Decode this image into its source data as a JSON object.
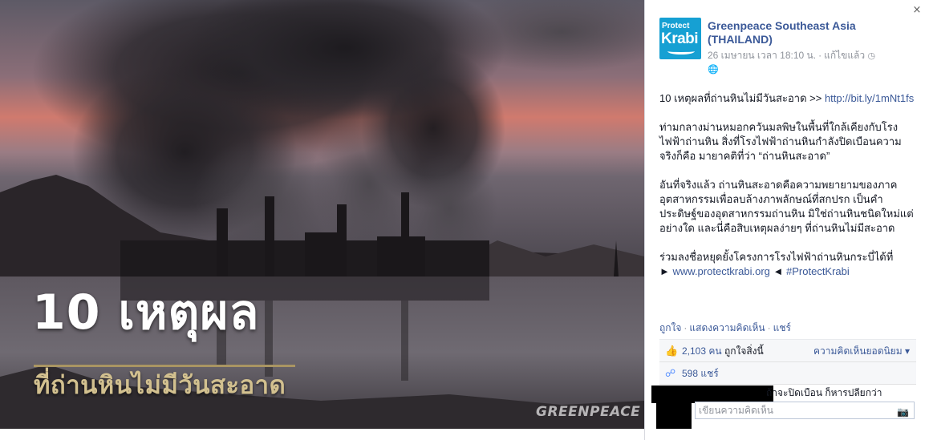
{
  "photo": {
    "overlay_title": "10 เหตุผล",
    "overlay_subtitle": "ที่ถ่านหินไม่มีวันสะอาด",
    "watermark": "GREENPEACE"
  },
  "panel": {
    "close_glyph": "×",
    "avatar": {
      "line1": "Protect",
      "line2": "Krabi"
    },
    "page_name": "Greenpeace Southeast Asia (THAILAND)",
    "meta": {
      "date": "26 เมษายน เวลา 18:10 น.",
      "edited": "แก้ไขแล้ว",
      "clock_icon": "clock-icon",
      "globe_icon": "globe-icon"
    },
    "post": {
      "p1_text": "10 เหตุผลที่ถ่านหินไม่มีวันสะอาด >> ",
      "p1_link": "http://bit.ly/1mNt1fs",
      "p2": "ท่ามกลางม่านหมอกควันมลพิษในพื้นที่ใกล้เคียงกับโรงไฟฟ้าถ่านหิน สิ่งที่โรงไฟฟ้าถ่านหินกำลังปิดเบือนความจริงก็คือ มายาคติที่ว่า “ถ่านหินสะอาด”",
      "p3": "อันที่จริงแล้ว ถ่านหินสะอาดคือความพยายามของภาคอุตสาหกรรมเพื่อลบล้างภาพลักษณ์ที่สกปรก เป็นคำประดิษฐ์ของอุตสาหกรรมถ่านหิน มิใช่ถ่านหินชนิดใหม่แต่อย่างใด และนี่คือสิบเหตุผลง่ายๆ ที่ถ่านหินไม่มีสะอาด",
      "p4_text": "ร่วมลงชื่อหยุดยั้งโครงการโรงไฟฟ้าถ่านหินกระบี่ได้ที่",
      "p4_arrow_left": "►",
      "p4_link": "www.protectkrabi.org",
      "p4_arrow_right": "◄",
      "p4_hashtag": "#ProtectKrabi"
    },
    "actions": {
      "like": "ถูกใจ",
      "comment": "แสดงความคิดเห็น",
      "share": "แชร์"
    },
    "feedback": {
      "likes_count": "2,103 คน",
      "likes_text": "ถูกใจสิ่งนี้",
      "top_comments": "ความคิดเห็นยอดนิยม",
      "shares": "598 แชร์"
    },
    "truncated_comment": "ถ้าจะปิดเบือน ก็หารปลี่ยกว่า",
    "comment_placeholder": "เขียนความคิดเห็น"
  },
  "colors": {
    "link": "#3b5998",
    "avatar_bg": "#16a0d3",
    "overlay_gold": "#d2c08f"
  }
}
